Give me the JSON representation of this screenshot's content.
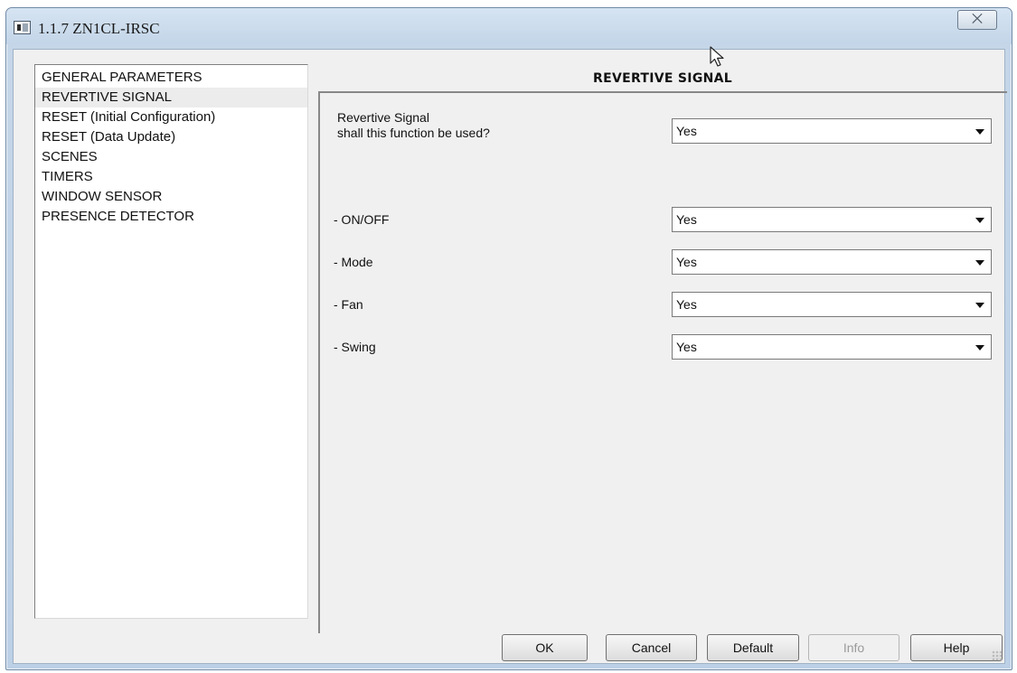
{
  "window": {
    "title": "1.1.7 ZN1CL-IRSC",
    "close_glyph": "⨉"
  },
  "sidebar": {
    "items": [
      {
        "label": "GENERAL PARAMETERS",
        "selected": false
      },
      {
        "label": "REVERTIVE SIGNAL",
        "selected": true
      },
      {
        "label": "RESET (Initial Configuration)",
        "selected": false
      },
      {
        "label": "RESET (Data Update)",
        "selected": false
      },
      {
        "label": "SCENES",
        "selected": false
      },
      {
        "label": "TIMERS",
        "selected": false
      },
      {
        "label": "WINDOW SENSOR",
        "selected": false
      },
      {
        "label": "PRESENCE DETECTOR",
        "selected": false
      }
    ]
  },
  "main": {
    "header": "REVERTIVE SIGNAL",
    "params": [
      {
        "label_line1": "Revertive Signal",
        "label_line2": "shall this function be used?",
        "value": "Yes"
      },
      {
        "label": "- ON/OFF",
        "value": "Yes"
      },
      {
        "label": "- Mode",
        "value": "Yes"
      },
      {
        "label": "- Fan",
        "value": "Yes"
      },
      {
        "label": "- Swing",
        "value": "Yes"
      }
    ]
  },
  "buttons": {
    "ok": "OK",
    "cancel": "Cancel",
    "default": "Default",
    "info": "Info",
    "help": "Help"
  },
  "icons": {
    "app": "app-window-icon",
    "close": "close-icon",
    "dropdown": "chevron-down-icon",
    "cursor": "mouse-pointer-icon",
    "grip": "resize-grip-icon"
  },
  "colors": {
    "frame": "#c5d6e8",
    "client_bg": "#f0f0f0",
    "selection": "#ececec",
    "disabled_text": "#9a9a9a"
  }
}
